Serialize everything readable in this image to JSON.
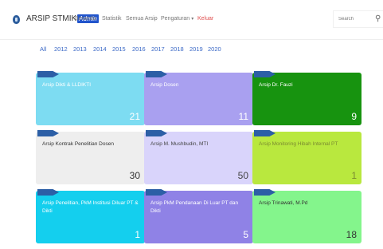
{
  "brand": {
    "name": "ARSIP STMIK",
    "badge": "Admin"
  },
  "nav": {
    "home": "Beranda",
    "stats": "Statistik",
    "all_archives": "Semua Arsip",
    "settings": "Pengaturan",
    "logout": "Keluar"
  },
  "search": {
    "placeholder": "Search"
  },
  "years": [
    "All",
    "2012",
    "2013",
    "2014",
    "2015",
    "2016",
    "2017",
    "2018",
    "2019",
    "2020"
  ],
  "cards": [
    {
      "title": "Arsip Dikti & LLDIKTI",
      "count": "21",
      "color": "#7ddcf2",
      "text_color": "#ffffff"
    },
    {
      "title": "Arsip Dosen",
      "count": "11",
      "color": "#a9a0f0",
      "text_color": "#ffffff"
    },
    {
      "title": "Arsip Dr. Fauzi",
      "count": "9",
      "color": "#17930f",
      "text_color": "#ffffff"
    },
    {
      "title": "Arsip Kontrak Penelitian Dosen",
      "count": "30",
      "color": "#eeeeee",
      "text_color": "#333333"
    },
    {
      "title": "Arsip M. Mushbudin, MTI",
      "count": "50",
      "color": "#d9d4fb",
      "text_color": "#444444"
    },
    {
      "title": "Arsip Monitoring Hibah Internal PT",
      "count": "1",
      "color": "#b9e83e",
      "text_color": "#7a8a30"
    },
    {
      "title": "Arsip Penelitian, PkM Institusi Diluar PT & Dikti",
      "count": "1",
      "color": "#14cfee",
      "text_color": "#ffffff"
    },
    {
      "title": "Arsip PkM Pendanaan Di Luar PT dan Dikti",
      "count": "5",
      "color": "#8f82e6",
      "text_color": "#ffffff"
    },
    {
      "title": "Arsip Trinawati, M.Pd",
      "count": "18",
      "color": "#84f58c",
      "text_color": "#333333"
    }
  ]
}
